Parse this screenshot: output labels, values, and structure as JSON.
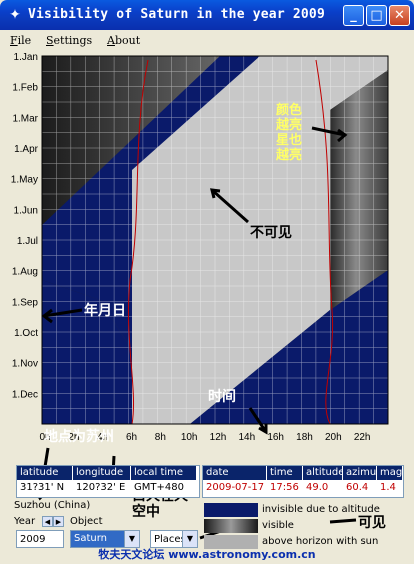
{
  "window": {
    "title": "Visibility of Saturn in the year 2009"
  },
  "menu": {
    "file": "ile",
    "file_key": "F",
    "settings": "ettings",
    "settings_key": "S",
    "about": "bout",
    "about_key": "A"
  },
  "months": [
    "1.Jan",
    "1.Feb",
    "1.Mar",
    "1.Apr",
    "1.May",
    "1.Jun",
    "1.Jul",
    "1.Aug",
    "1.Sep",
    "1.Oct",
    "1.Nov",
    "1.Dec"
  ],
  "hours": [
    "0h",
    "2h",
    "4h",
    "6h",
    "8h",
    "10h",
    "12h",
    "14h",
    "16h",
    "18h",
    "20h",
    "22h"
  ],
  "location_table": {
    "headers": [
      "latitude",
      "longitude",
      "local time"
    ],
    "values": [
      "31?31' N",
      "120?32' E",
      "GMT+480"
    ]
  },
  "object_table": {
    "headers": [
      "date",
      "time",
      "altitude",
      "azimut",
      "mag"
    ],
    "values": [
      "2009-07-17",
      "17:56",
      "49.0",
      "60.4",
      "1.4"
    ]
  },
  "controls": {
    "location_name": "Suzhou (China)",
    "year_label": "Year",
    "object_label": "Object",
    "year_value": "2009",
    "object_value": "Saturn",
    "places_label": "Places"
  },
  "legend": [
    {
      "label": "invisible due to altitude",
      "color": "#0a1a6a"
    },
    {
      "label": "visible",
      "color": "#888888"
    },
    {
      "label": "above horizon with sun",
      "color": "#b0b0b0"
    }
  ],
  "annotations": {
    "color_brightness": "颜色越亮星也越亮",
    "not_visible": "不可见",
    "date_axis": "年月日",
    "time_axis": "时间",
    "location": "地点为苏州",
    "daytime": "白天在天空中",
    "visible": "可见"
  },
  "footer": "牧夫天文论坛 www.astronomy.com.cn",
  "colors": {
    "night_band": "#0a1a6a",
    "day_band": "#c8c8c8",
    "titlebar": "#0a3fc9"
  }
}
